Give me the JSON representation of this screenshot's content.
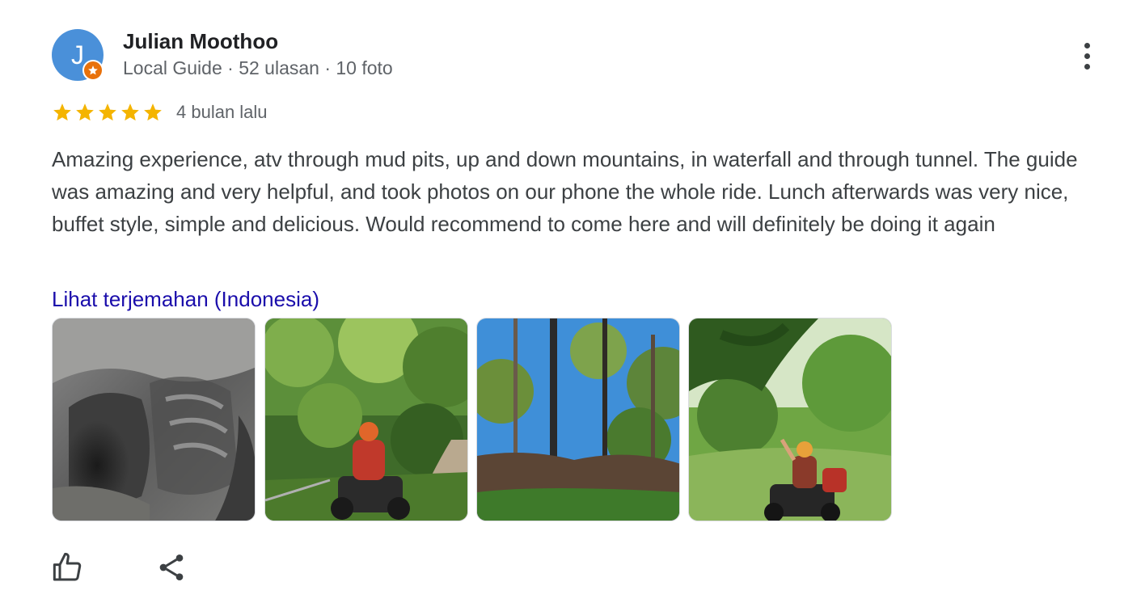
{
  "reviewer": {
    "initial": "J",
    "name": "Julian Moothoo",
    "meta": "Local Guide · 52 ulasan · 10 foto",
    "avatar_color": "#4a90d9",
    "badge_color": "#e8710a"
  },
  "rating": {
    "stars": 5,
    "max_stars": 5,
    "star_color": "#f4b400",
    "time_ago": "4 bulan lalu"
  },
  "review": {
    "text": "Amazing experience, atv through mud pits, up and down mountains, in waterfall and through tunnel. The guide was amazing and very helpful, and took photos on our phone the whole ride. Lunch afterwards was very nice, buffet style, simple and delicious. Would recommend to come here and will definitely be doing it again",
    "translate_link": "Lihat terjemahan (Indonesia)",
    "link_color": "#1a0dab"
  },
  "photos": [
    {
      "subject": "rock-tunnel"
    },
    {
      "subject": "atv-rider-jungle-path"
    },
    {
      "subject": "forest-trees-blue-sky"
    },
    {
      "subject": "atv-rider-waving-under-leaves"
    }
  ],
  "actions": {
    "like_icon": "thumbs-up-icon",
    "share_icon": "share-icon",
    "more_icon": "more-vert-icon"
  }
}
